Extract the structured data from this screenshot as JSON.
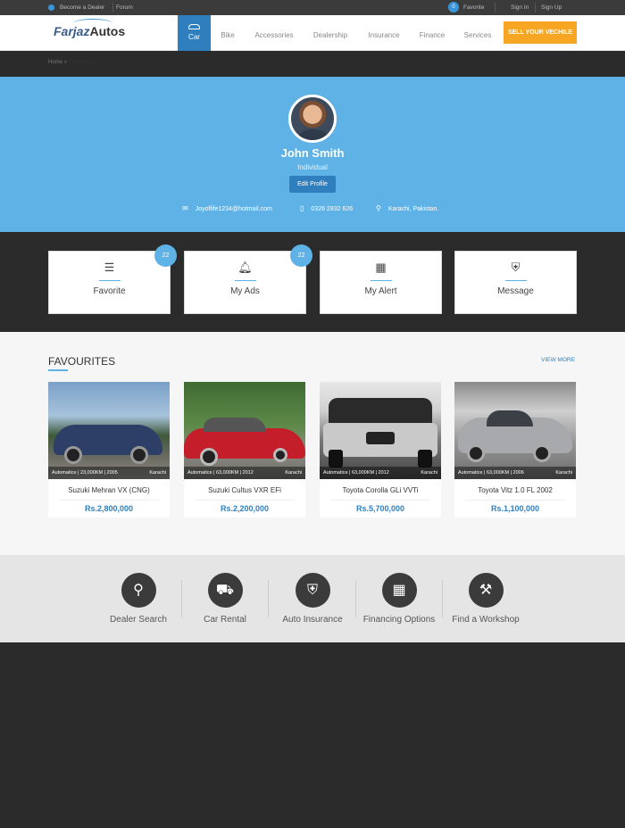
{
  "topbar": {
    "become_dealer": "Become a Dealer",
    "forum": "Forum",
    "favorite_count": "0",
    "favorite": "Favorite",
    "sign_in": "Sign In",
    "sign_up": "Sign Up"
  },
  "header": {
    "logo_part1": "Farjaz",
    "logo_part2": "Autos",
    "nav": [
      "Car",
      "Bike",
      "Accessories",
      "Dealership",
      "Insurance",
      "Finance",
      "Services"
    ],
    "sell_button": "SELL YOUR VECHILE"
  },
  "breadcrumb": {
    "home": "Home",
    "separator": "»",
    "current": "Dashboard"
  },
  "profile": {
    "name": "John Smith",
    "type": "Individual",
    "edit_button": "Edit Profile",
    "email": "Joyoflife1234@hotmail.com",
    "phone": "0326 2832 626",
    "location": "Karachi, Pakistan."
  },
  "stats": [
    {
      "label": "Favorite",
      "badge": "22",
      "icon": "list-icon"
    },
    {
      "label": "My Ads",
      "badge": "22",
      "icon": "bell-icon"
    },
    {
      "label": "My Alert",
      "badge": "",
      "icon": "calculator-icon"
    },
    {
      "label": "Message",
      "badge": "",
      "icon": "shield-car-icon"
    }
  ],
  "favourites": {
    "title": "FAVOURITES",
    "view_more": "VIEW MORE",
    "cards": [
      {
        "meta": "Automatice | 23,000KM | 2005",
        "city": "Karachi",
        "title": "Suzuki Mehran VX (CNG)",
        "price": "Rs.2,800,000"
      },
      {
        "meta": "Automatice | 63,000KM | 2012",
        "city": "Karachi",
        "title": "Suzuki Cultus VXR EFi",
        "price": "Rs.2,200,000"
      },
      {
        "meta": "Automatice | 63,000KM | 2012",
        "city": "Karachi",
        "title": "Toyota Corolla GLi VVTi",
        "price": "Rs.5,700,000"
      },
      {
        "meta": "Automatice | 63,000KM | 2006",
        "city": "Karachi",
        "title": "Toyota Vitz 1.0 FL 2002",
        "price": "Rs.1,100,000"
      }
    ]
  },
  "services": [
    {
      "label": "Dealer Search",
      "icon": "map-pin-icon"
    },
    {
      "label": "Car Rental",
      "icon": "car-key-icon"
    },
    {
      "label": "Auto Insurance",
      "icon": "shield-car-icon"
    },
    {
      "label": "Financing Options",
      "icon": "calculator-icon"
    },
    {
      "label": "Find a Workshop",
      "icon": "car-wrench-icon"
    }
  ],
  "colors": {
    "primary": "#2f7fbf",
    "banner": "#5fb2e6",
    "accent": "#f6a623",
    "footer": "#2b2b2b"
  }
}
